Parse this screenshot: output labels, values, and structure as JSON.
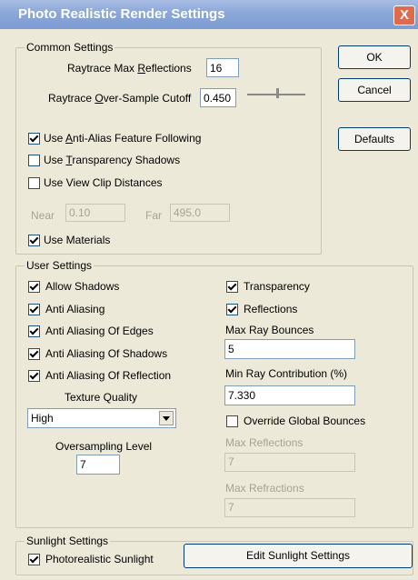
{
  "window": {
    "title": "Photo Realistic Render Settings",
    "close_label": "X"
  },
  "buttons": {
    "ok": "OK",
    "cancel": "Cancel",
    "defaults": "Defaults"
  },
  "common": {
    "legend": "Common Settings",
    "max_reflections_label": "Raytrace Max Reflections",
    "max_reflections_value": "16",
    "oversample_label": "Raytrace Over-Sample Cutoff",
    "oversample_value": "0.450",
    "oversample_slider_fraction": 0.5,
    "anti_alias_label": "Use Anti-Alias Feature Following",
    "anti_alias_checked": true,
    "transparency_shadows_label": "Use Transparency Shadows",
    "transparency_shadows_checked": false,
    "view_clip_label": "Use View Clip Distances",
    "view_clip_checked": false,
    "near_label": "Near",
    "near_value": "0.10",
    "far_label": "Far",
    "far_value": "495.0",
    "use_materials_label": "Use Materials",
    "use_materials_checked": true
  },
  "user": {
    "legend": "User Settings",
    "allow_shadows": "Allow Shadows",
    "anti_aliasing": "Anti Aliasing",
    "aa_edges": "Anti Aliasing Of Edges",
    "aa_shadows": "Anti Aliasing Of Shadows",
    "aa_reflection": "Anti Aliasing Of Reflection",
    "texture_quality_label": "Texture Quality",
    "texture_quality_value": "High",
    "oversampling_level_label": "Oversampling Level",
    "oversampling_level_value": "7",
    "transparency": "Transparency",
    "reflections": "Reflections",
    "max_ray_bounces_label": "Max Ray Bounces",
    "max_ray_bounces_value": "5",
    "min_ray_contribution_label": "Min Ray Contribution (%)",
    "min_ray_contribution_value": "7.330",
    "override_global_label": "Override Global Bounces",
    "override_global_checked": false,
    "max_reflections_label": "Max Reflections",
    "max_reflections_value": "7",
    "max_refractions_label": "Max Refractions",
    "max_refractions_value": "7"
  },
  "sunlight": {
    "legend": "Sunlight Settings",
    "photorealistic_label": "Photorealistic Sunlight",
    "photorealistic_checked": true,
    "edit_button": "Edit Sunlight Settings"
  }
}
